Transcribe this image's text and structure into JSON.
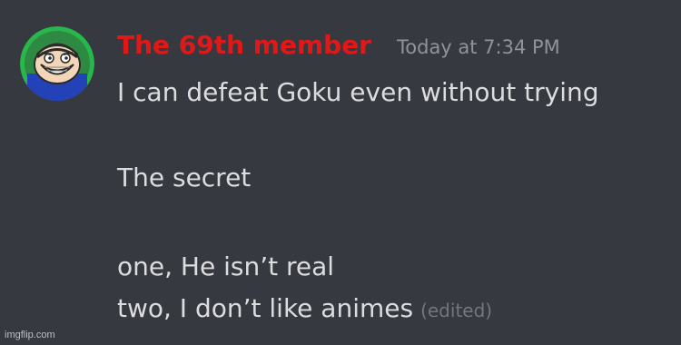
{
  "message": {
    "author": {
      "name": "The 69th member",
      "avatar_icon": "trollface-avatar-icon",
      "name_color": "#e11818"
    },
    "timestamp": "Today at 7:34 PM",
    "lines": [
      "I can defeat Goku even without trying",
      "The secret",
      "one, He isn’t real",
      "two, I don’t like animes"
    ],
    "edited_label": "(edited)"
  },
  "watermark": "imgflip.com",
  "colors": {
    "background": "#36393f",
    "message_text": "#dcddde",
    "timestamp_text": "#8f949b",
    "edited_text": "#72767d",
    "avatar_ring": "#27b74a"
  }
}
